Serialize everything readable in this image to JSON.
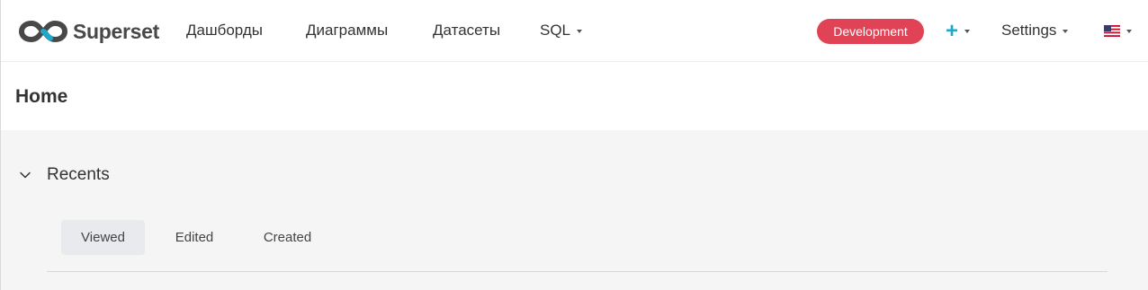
{
  "navbar": {
    "brand": "Superset",
    "items": [
      {
        "label": "Дашборды"
      },
      {
        "label": "Диаграммы"
      },
      {
        "label": "Датасеты"
      },
      {
        "label": "SQL"
      }
    ],
    "environment_badge": "Development",
    "plus_label": "+",
    "settings_label": "Settings"
  },
  "page": {
    "title": "Home"
  },
  "recents": {
    "label": "Recents",
    "tabs": [
      {
        "label": "Viewed",
        "active": true
      },
      {
        "label": "Edited",
        "active": false
      },
      {
        "label": "Created",
        "active": false
      }
    ]
  },
  "colors": {
    "accent": "#20a7c9",
    "badge": "#e04355",
    "logo_dark": "#484848"
  },
  "icons": [
    "superset-logo-icon",
    "caret-down-icon",
    "plus-icon",
    "us-flag-icon",
    "chevron-down-icon"
  ]
}
